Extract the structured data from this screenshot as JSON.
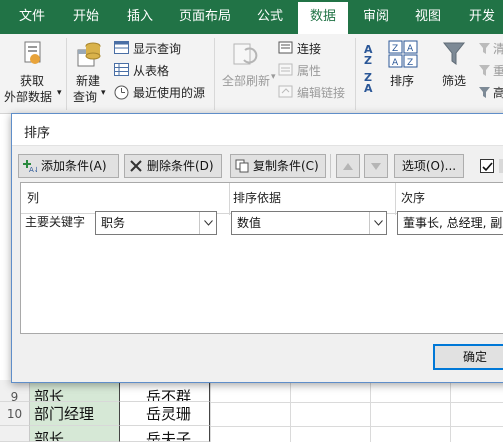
{
  "ribbon_tabs": [
    {
      "label": "文件"
    },
    {
      "label": "开始"
    },
    {
      "label": "插入"
    },
    {
      "label": "页面布局"
    },
    {
      "label": "公式"
    },
    {
      "label": "数据"
    },
    {
      "label": "审阅"
    },
    {
      "label": "视图"
    },
    {
      "label": "开发"
    }
  ],
  "active_tab": "数据",
  "ribbon": {
    "get_external_data": {
      "line1": "获取",
      "line2": "外部数据"
    },
    "new_query": {
      "line1": "新建",
      "line2": "查询"
    },
    "show_queries": "显示查询",
    "from_table": "从表格",
    "recent_sources": "最近使用的源",
    "refresh_all": "全部刷新",
    "connections": "连接",
    "properties": "属性",
    "edit_links": "编辑链接",
    "sort": "排序",
    "filter": "筛选",
    "clear": "清",
    "reapply": "重",
    "advanced": "高"
  },
  "dialog": {
    "title": "排序",
    "add_level": "添加条件(A)",
    "delete_level": "删除条件(D)",
    "copy_level": "复制条件(C)",
    "options": "选项(O)...",
    "headers": {
      "column": "列",
      "sort_on": "排序依据",
      "order": "次序"
    },
    "row": {
      "label": "主要关键字",
      "column": "职务",
      "sort_on": "数值",
      "order": "董事长, 总经理, 副总"
    },
    "ok": "确定",
    "accent": "#0078d7"
  },
  "grid": {
    "rows": [
      {
        "num": "9",
        "col_a": "部长",
        "col_b": "岳不群"
      },
      {
        "num": "10",
        "col_a": "部门经理",
        "col_b": "岳灵珊"
      },
      {
        "num": "",
        "col_a": "部长",
        "col_b": "岳夫子"
      }
    ]
  },
  "colors": {
    "excel_green": "#217346",
    "tab_active_text": "#217346",
    "dialog_border": "#5f8ec9"
  }
}
